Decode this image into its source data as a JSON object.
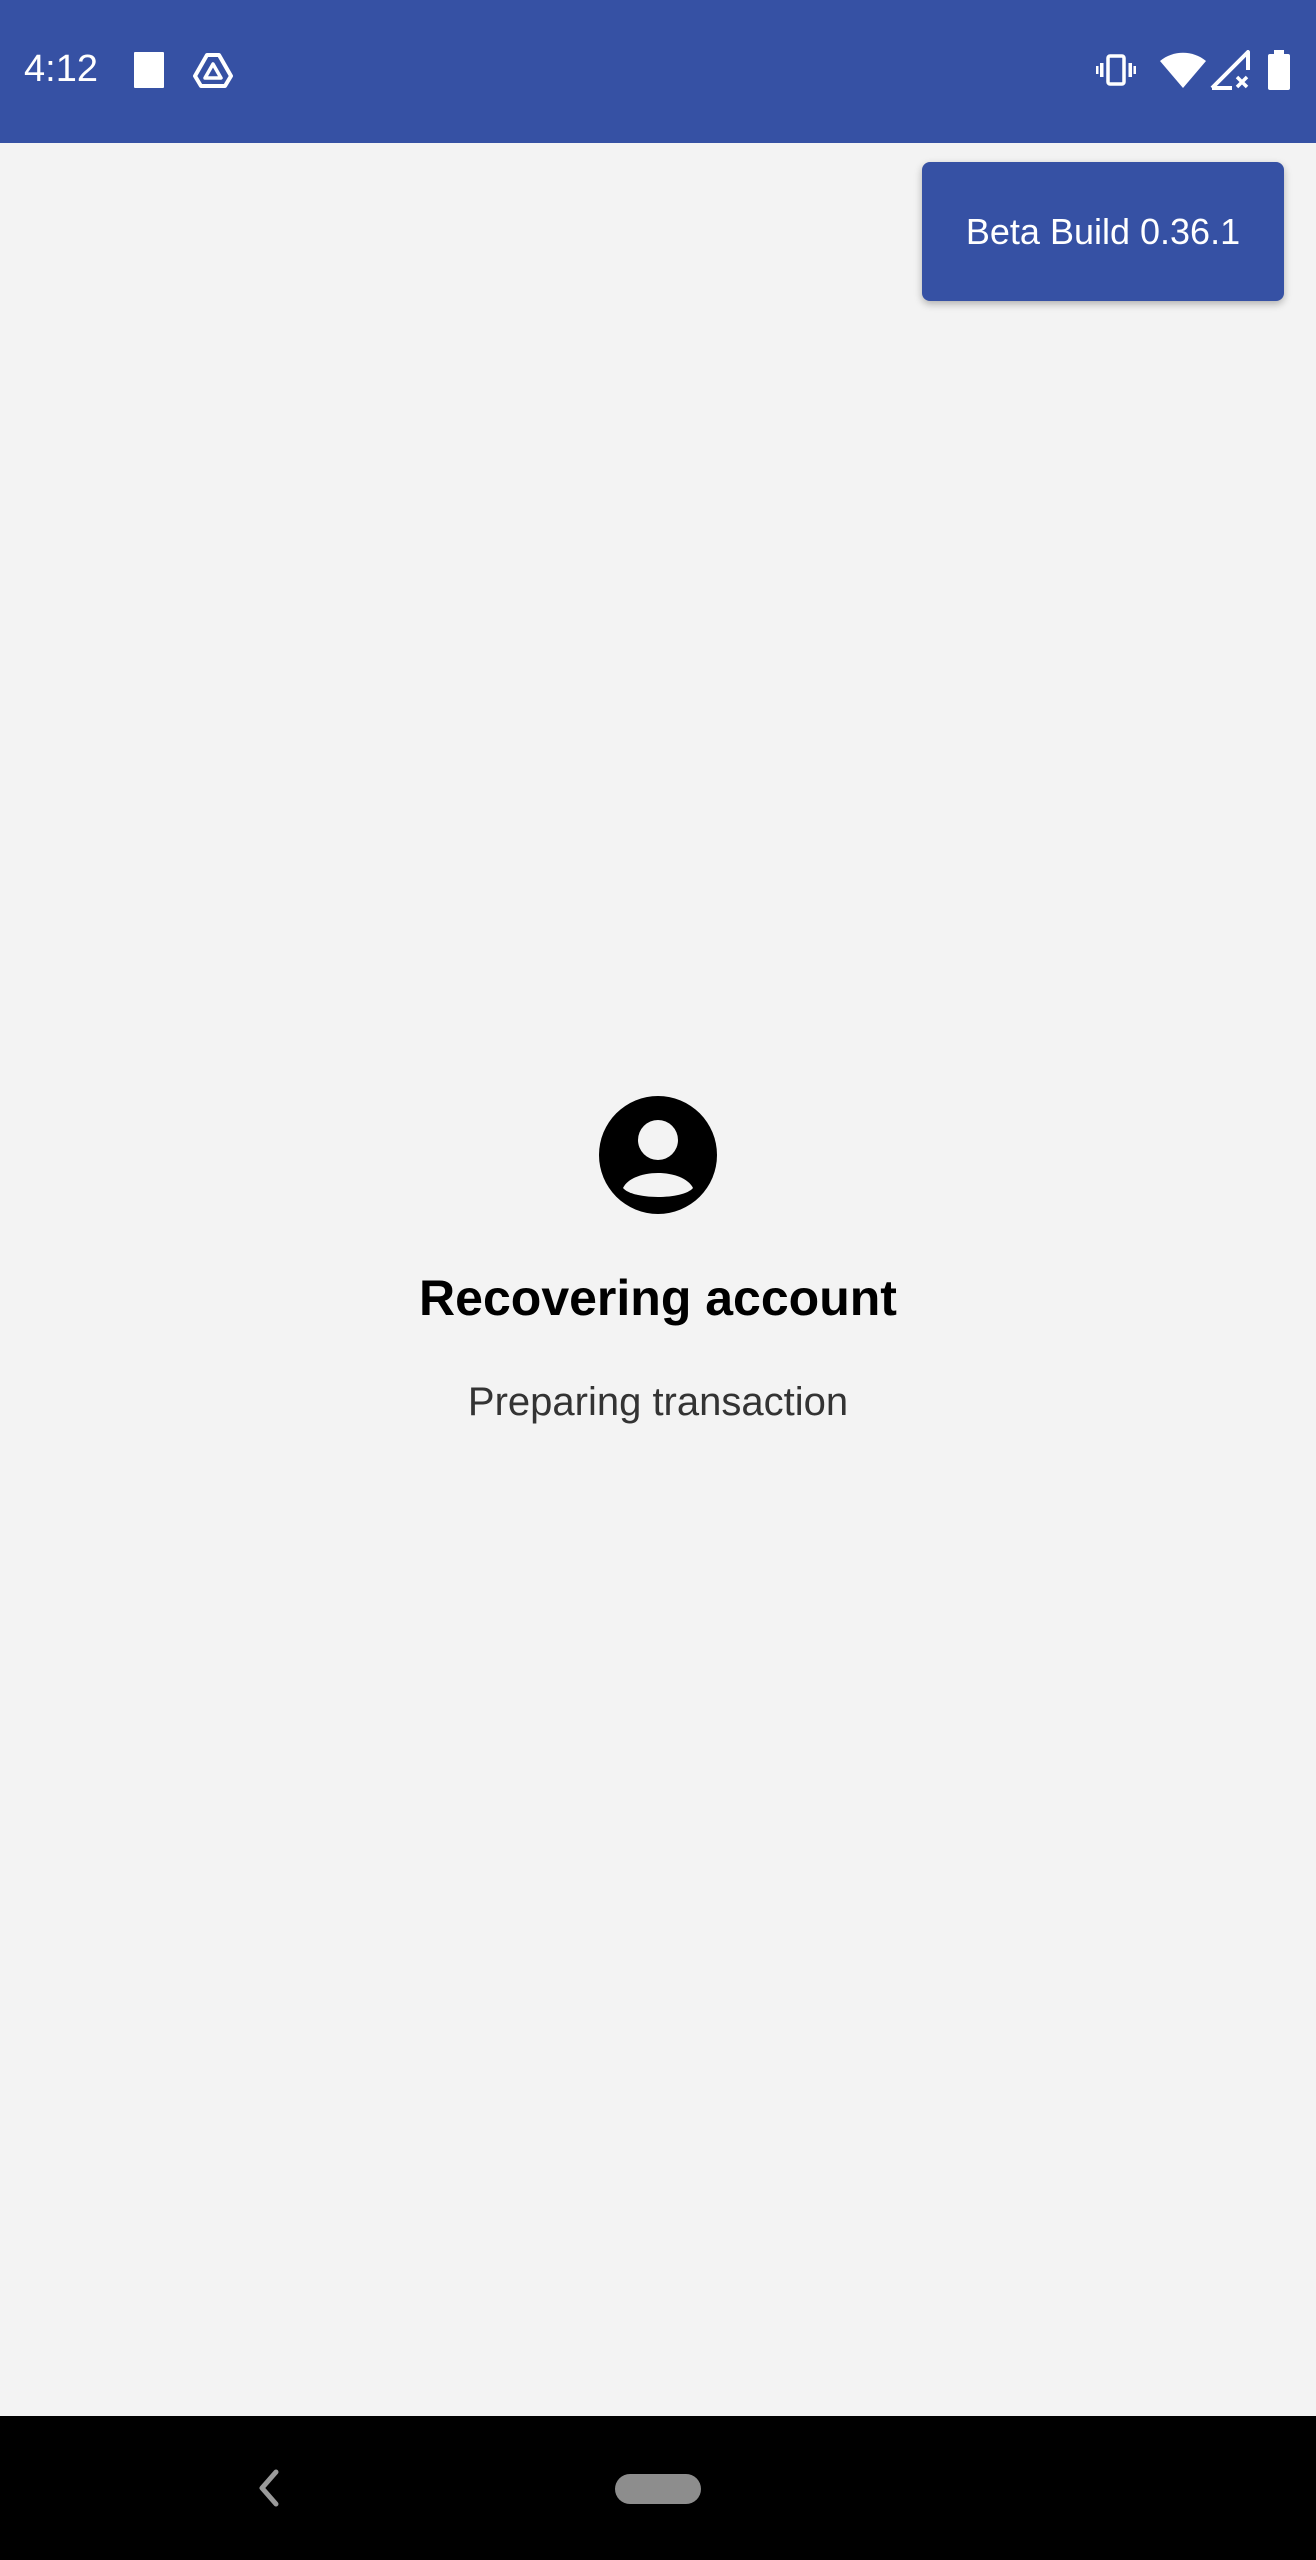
{
  "status_bar": {
    "time": "4:12",
    "background_color": "#3651a4",
    "left_icons": [
      "sd-card-icon",
      "drive-icon"
    ],
    "right_icons": [
      "vibrate-icon",
      "wifi-icon",
      "cellular-no-signal-icon",
      "battery-icon"
    ]
  },
  "beta_badge": {
    "label": "Beta Build 0.36.1",
    "color": "#3651a4"
  },
  "content": {
    "icon": "account-circle-icon",
    "title": "Recovering account",
    "subtitle": "Preparing transaction"
  },
  "nav_bar": {
    "back_icon": "back-chevron-icon",
    "home_icon": "home-pill-icon"
  }
}
